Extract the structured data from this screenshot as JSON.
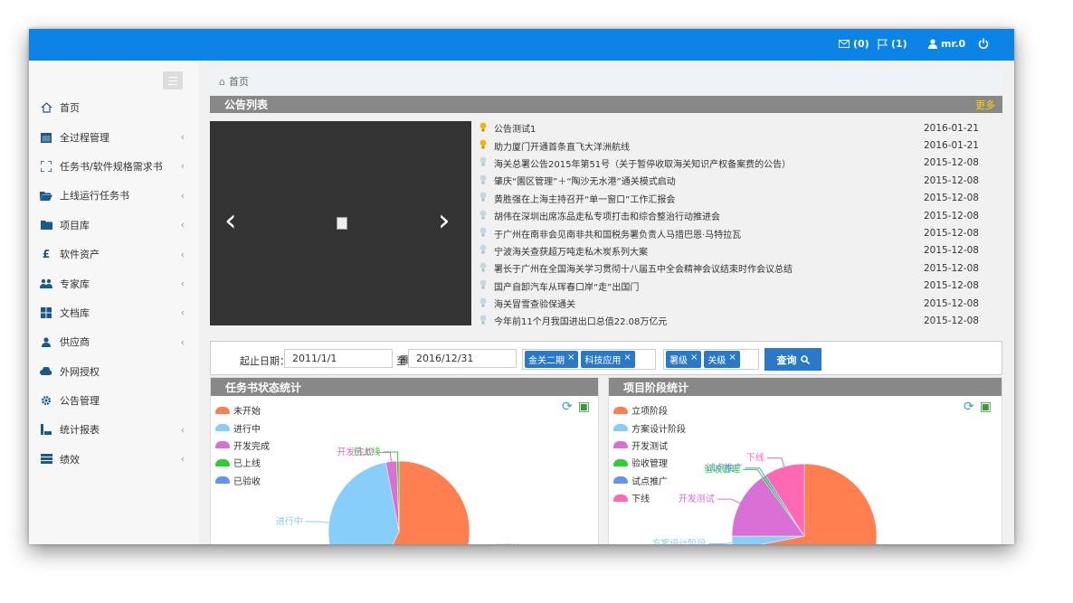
{
  "topbar": {
    "mail_count": "(0)",
    "flag_count": "(1)",
    "user_name": "mr.0"
  },
  "sidebar": {
    "items": [
      {
        "label": "首页",
        "icon": "home-icon"
      },
      {
        "label": "全过程管理",
        "icon": "calendar-icon"
      },
      {
        "label": "任务书/软件规格需求书",
        "icon": "expand-icon"
      },
      {
        "label": "上线运行任务书",
        "icon": "folder-open-icon"
      },
      {
        "label": "项目库",
        "icon": "folder-icon"
      },
      {
        "label": "软件资产",
        "icon": "pound-icon"
      },
      {
        "label": "专家库",
        "icon": "users-icon"
      },
      {
        "label": "文档库",
        "icon": "grid-icon"
      },
      {
        "label": "供应商",
        "icon": "user-icon"
      },
      {
        "label": "外网授权",
        "icon": "cloud-icon"
      },
      {
        "label": "公告管理",
        "icon": "gear-icon"
      },
      {
        "label": "统计报表",
        "icon": "report-icon"
      },
      {
        "label": "绩效",
        "icon": "tasks-icon"
      }
    ]
  },
  "breadcrumb": {
    "home": "首页"
  },
  "notice_panel": {
    "title": "公告列表",
    "more": "更多",
    "items": [
      {
        "title": "公告测试1",
        "date": "2016-01-21",
        "highlight": true
      },
      {
        "title": "助力厦门开通首条直飞大洋洲航线",
        "date": "2016-01-21",
        "highlight": true
      },
      {
        "title": "海关总署公告2015年第51号（关于暂停收取海关知识产权备案费的公告）",
        "date": "2015-12-08",
        "highlight": false
      },
      {
        "title": "肇庆“園区管理”＋“陶沙无水港”通关模式启动",
        "date": "2015-12-08",
        "highlight": false
      },
      {
        "title": "黄胜强在上海主持召开“单一窗口”工作汇报会",
        "date": "2015-12-08",
        "highlight": false
      },
      {
        "title": "胡伟在深圳出席冻品走私专项打击和综合整治行动推进会",
        "date": "2015-12-08",
        "highlight": false
      },
      {
        "title": "于广州在南非会见南非共和国税务署负责人马措巴恩·马特拉瓦",
        "date": "2015-12-08",
        "highlight": false
      },
      {
        "title": "宁波海关查获超万吨走私木炭系列大案",
        "date": "2015-12-08",
        "highlight": false
      },
      {
        "title": "署长于广州在全国海关学习贯彻十八届五中全会精神会议结束时作会议总结",
        "date": "2015-12-08",
        "highlight": false
      },
      {
        "title": "国产自卸汽车从珲春口岸“走”出国门",
        "date": "2015-12-08",
        "highlight": false
      },
      {
        "title": "海关冒雪查验保通关",
        "date": "2015-12-08",
        "highlight": false
      },
      {
        "title": "今年前11个月我国进出口总值22.08万亿元",
        "date": "2015-12-08",
        "highlight": false
      }
    ]
  },
  "filter": {
    "label": "起止日期：",
    "start_date": "2011/1/1",
    "to": "至",
    "end_date": "2016/12/31",
    "tags1": [
      "金关二期",
      "科技应用"
    ],
    "tags2": [
      "署级",
      "关级"
    ],
    "search_label": "查询"
  },
  "chart_data": [
    {
      "type": "pie",
      "title": "任务书状态统计",
      "categories": [
        "未开始",
        "进行中",
        "开发完成",
        "已上线",
        "已验收"
      ],
      "values": [
        57,
        40,
        2.5,
        0.5,
        0
      ],
      "colors": [
        "#ff7f50",
        "#87cefa",
        "#da70d6",
        "#32cd32",
        "#6495ed"
      ],
      "labels_shown": [
        "未开始",
        "进行中",
        "开发完成",
        "已上线"
      ]
    },
    {
      "type": "pie",
      "title": "项目阶段统计",
      "categories": [
        "立项阶段",
        "方案设计阶段",
        "开发测试",
        "验收管理",
        "试点推广",
        "下线"
      ],
      "values": [
        72,
        3,
        15,
        0.5,
        0.5,
        9
      ],
      "colors": [
        "#ff7f50",
        "#87cefa",
        "#da70d6",
        "#32cd32",
        "#6495ed",
        "#ff69b4"
      ],
      "labels_shown": [
        "方案设计阶段",
        "开发测试",
        "验收管理",
        "试点推广",
        "下线"
      ]
    }
  ]
}
